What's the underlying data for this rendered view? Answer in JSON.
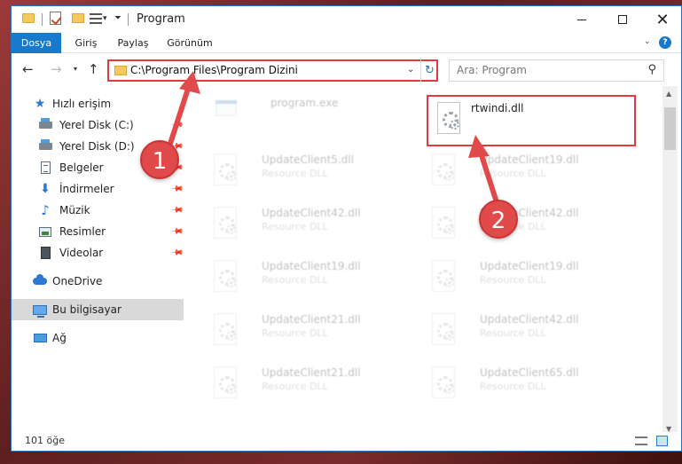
{
  "window": {
    "title": "Program",
    "controls": {
      "minimize": "",
      "maximize": "",
      "close": "✕"
    }
  },
  "ribbon": {
    "tabs": [
      "Dosya",
      "Giriş",
      "Paylaş",
      "Görünüm"
    ],
    "help": "?"
  },
  "address": {
    "path": "C:\\Program Files\\Program Dizini",
    "refresh": "↻"
  },
  "search": {
    "placeholder": "Ara: Program",
    "icon": "⚲"
  },
  "sidebar": {
    "items": [
      {
        "label": "Hızlı erişim",
        "icon": "star-icon",
        "pinned": false
      },
      {
        "label": "Yerel Disk (C:)",
        "icon": "drive-icon",
        "pinned": true
      },
      {
        "label": "Yerel Disk (D:)",
        "icon": "drive-icon",
        "pinned": true
      },
      {
        "label": "Belgeler",
        "icon": "document-icon",
        "pinned": true
      },
      {
        "label": "İndirmeler",
        "icon": "download-icon",
        "pinned": true
      },
      {
        "label": "Müzik",
        "icon": "music-icon",
        "pinned": true
      },
      {
        "label": "Resimler",
        "icon": "pictures-icon",
        "pinned": true
      },
      {
        "label": "Videolar",
        "icon": "video-icon",
        "pinned": true
      },
      {
        "label": "OneDrive",
        "icon": "cloud-icon",
        "pinned": false
      },
      {
        "label": "Bu bilgisayar",
        "icon": "computer-icon",
        "pinned": false,
        "selected": true
      },
      {
        "label": "Ağ",
        "icon": "network-icon",
        "pinned": false
      }
    ]
  },
  "files": [
    {
      "name": "program.exe",
      "type": "",
      "faded": true,
      "highlighted": false
    },
    {
      "name": "rtwindi.dll",
      "type": "",
      "faded": false,
      "highlighted": true
    },
    {
      "name": "UpdateClient5.dll",
      "type": "Resource DLL",
      "faded": true
    },
    {
      "name": "UpdateClient19.dll",
      "type": "Resource DLL",
      "faded": true
    },
    {
      "name": "UpdateClient42.dll",
      "type": "Resource DLL",
      "faded": true
    },
    {
      "name": "UpdateClient42.dll",
      "type": "Resource DLL",
      "faded": true
    },
    {
      "name": "UpdateClient19.dll",
      "type": "Resource DLL",
      "faded": true
    },
    {
      "name": "UpdateClient19.dll",
      "type": "Resource DLL",
      "faded": true
    },
    {
      "name": "UpdateClient21.dll",
      "type": "Resource DLL",
      "faded": true
    },
    {
      "name": "UpdateClient42.dll",
      "type": "Resource DLL",
      "faded": true
    },
    {
      "name": "UpdateClient21.dll",
      "type": "Resource DLL",
      "faded": true
    },
    {
      "name": "UpdateClient65.dll",
      "type": "Resource DLL",
      "faded": true
    }
  ],
  "status": {
    "count": "101 öğe"
  },
  "annotations": {
    "step1": "1",
    "step2": "2",
    "color": "#e14a4a"
  }
}
